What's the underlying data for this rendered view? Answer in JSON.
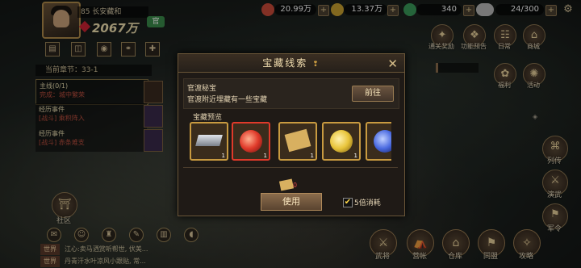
{
  "player": {
    "name": "85 长安藏和",
    "power": "2067万",
    "badge": "官"
  },
  "resources": [
    {
      "value": "20.99万",
      "icon": "silver-coin-icon",
      "color": "#c94a3a"
    },
    {
      "value": "13.37万",
      "icon": "gold-coin-icon",
      "color": "#c8a030"
    },
    {
      "value": "340",
      "icon": "jade-icon",
      "color": "#3a9a5a"
    },
    {
      "value": "24/300",
      "icon": "stamina-icon",
      "color": "#b8b8b8"
    }
  ],
  "top_icons": [
    {
      "label": "通关奖励",
      "icon": "reward-icon"
    },
    {
      "label": "功能预告",
      "icon": "preview-icon"
    },
    {
      "label": "日常",
      "icon": "daily-icon"
    },
    {
      "label": "商城",
      "icon": "shop-icon"
    }
  ],
  "right_icons": [
    {
      "label": "福利",
      "icon": "gift-icon"
    },
    {
      "label": "活动",
      "icon": "event-icon"
    }
  ],
  "side_buttons": [
    {
      "label": "列传",
      "icon": "scroll-icon"
    },
    {
      "label": "演武",
      "icon": "sword-icon"
    },
    {
      "label": "军令",
      "icon": "flag-icon"
    }
  ],
  "quest": {
    "header": "当前章节：33-1",
    "items": [
      {
        "title": "主线(0/1)",
        "sub": "完成：城中繁荣"
      },
      {
        "title": "经历事件",
        "sub": "[战斗] 乘积阵入"
      },
      {
        "title": "经历事件",
        "sub": "[战斗] 赤条难支"
      }
    ]
  },
  "community": {
    "label": "社区"
  },
  "dialog": {
    "title": "宝藏线索",
    "info_title": "官渡秘宝",
    "info_desc": "官渡附近埋藏有一些宝藏",
    "go_label": "前往",
    "preview_label": "宝藏预览",
    "items": [
      {
        "name": "silver-bar",
        "count": "1",
        "color": "#9aa0a8"
      },
      {
        "name": "red-orb",
        "count": "1",
        "color": "#e03a2a"
      },
      {
        "name": "treasure-map",
        "count": "1",
        "color": "#d8b060"
      },
      {
        "name": "gold-orb",
        "count": "1",
        "color": "#e8c43a"
      },
      {
        "name": "blue-orb",
        "count": "1",
        "color": "#4a6ae0"
      }
    ],
    "map_count": "0",
    "use_label": "使用",
    "checkbox_label": "5倍消耗",
    "checkbox_checked": true
  },
  "chat": [
    {
      "tag": "世界",
      "text": "江心:卖马洒赏听帮世, 伏美..."
    },
    {
      "tag": "世界",
      "text": "丹青汗水叶凉风小跟贴, 常..."
    }
  ],
  "bottom_nav": [
    {
      "label": "武将",
      "icon": "general-icon"
    },
    {
      "label": "营帐",
      "icon": "tent-icon"
    },
    {
      "label": "仓库",
      "icon": "warehouse-icon"
    },
    {
      "label": "同盟",
      "icon": "alliance-icon"
    },
    {
      "label": "攻略",
      "icon": "guide-icon"
    }
  ]
}
